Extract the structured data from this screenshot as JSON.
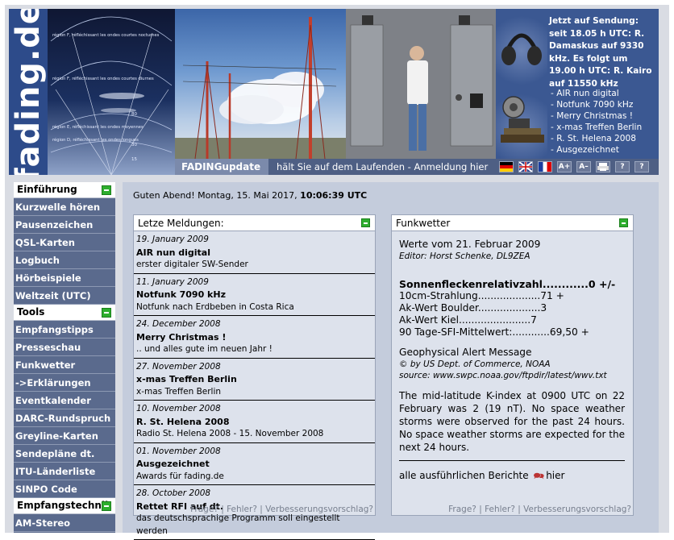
{
  "header": {
    "logo": "fading.de",
    "ionosphere_lines": [
      "région F, réfléchissant les ondes courtes nocturnes",
      "région F, réfléchissant les ondes courtes diurnes",
      "région E, réfléchissant les ondes moyennes",
      "région D, réfléchissant les ondes longues"
    ],
    "ionosphere_scale": [
      "80",
      "30",
      "15"
    ],
    "update_title": "FADINGupdate",
    "update_text": "hält Sie auf dem Laufenden - Anmeldung hier",
    "on_air_text": "Jetzt auf Sendung: seit 18.05 h UTC: R. Damaskus auf 9330 kHz. Es folgt um 19.00 h UTC: R. Kairo auf 11550 kHz",
    "news_ticker": [
      "AIR nun digital",
      "Notfunk 7090 kHz",
      "Merry Christmas !",
      "x-mas Treffen Berlin",
      "R. St. Helena 2008",
      "Ausgezeichnet"
    ],
    "tool_icons": [
      "flag-de-icon",
      "flag-uk-icon",
      "flag-fr-icon",
      "font-larger-icon",
      "font-smaller-icon",
      "print-icon",
      "help-icon",
      "help-icon"
    ],
    "tool_labels": [
      "A+",
      "A–",
      "?",
      "?"
    ]
  },
  "sidebar": {
    "sections": [
      {
        "label": "Einführung",
        "items": [
          "Kurzwelle hören",
          "Pausenzeichen",
          "QSL-Karten",
          "Logbuch",
          "Hörbeispiele",
          "Weltzeit (UTC)"
        ]
      },
      {
        "label": "Tools",
        "items": [
          "Empfangstipps",
          "Presseschau",
          "Funkwetter",
          "->Erklärungen",
          "Eventkalender",
          "DARC-Rundspruch",
          "Greyline-Karten",
          "Sendepläne dt.",
          "ITU-Länderliste",
          "SINPO Code"
        ]
      },
      {
        "label": "Empfangstechnik",
        "items": [
          "AM-Stereo"
        ]
      }
    ]
  },
  "main": {
    "greeting": "Guten Abend! Montag, 15. Mai 2017, ",
    "time": "10:06:39 UTC",
    "news": {
      "title": "Letze Meldungen:",
      "entries": [
        {
          "date": "19. January 2009",
          "title": "AIR nun digital",
          "desc": "erster digitaler SW-Sender"
        },
        {
          "date": "11. January 2009",
          "title": "Notfunk 7090 kHz",
          "desc": "Notfunk nach Erdbeben in Costa Rica"
        },
        {
          "date": "24. December 2008",
          "title": "Merry Christmas !",
          "desc": ".. und alles gute im neuen Jahr !"
        },
        {
          "date": "27. November 2008",
          "title": "x-mas Treffen Berlin",
          "desc": "x-mas Treffen Berlin"
        },
        {
          "date": "10. November 2008",
          "title": "R. St. Helena 2008",
          "desc": "Radio St. Helena 2008 - 15. November 2008"
        },
        {
          "date": "01. November 2008",
          "title": "Ausgezeichnet",
          "desc": "Awards für fading.de"
        },
        {
          "date": "28. October 2008",
          "title": "Rettet RFI auf dt.",
          "desc": "das deutschsprachige Programm soll eingestellt werden"
        }
      ],
      "footer": "Frage? | Fehler? | Verbesserungsvorschlag?"
    },
    "weather": {
      "title": "Funkwetter",
      "values_from": "Werte vom 21. Februar 2009",
      "editor": "Editor: Horst Schenke, DL9ZEA",
      "sunspot": "Sonnenfleckenrelativzahl............0 +/-",
      "lines": [
        "10cm-Strahlung....................71 +",
        "Ak-Wert Boulder....................3",
        "Ak-Wert Kiel.......................7",
        "90 Tage-SFI-Mittelwert:............69,50 +"
      ],
      "alert_title": "Geophysical Alert Message",
      "alert_copyright": "© by US Dept. of Commerce, NOAA",
      "alert_source": "source: www.swpc.noaa.gov/ftpdir/latest/wwv.txt",
      "alert_text": "The mid-latitude K-index at 0900 UTC on 22 February was 2 (19 nT). No space weather storms were observed for the past 24 hours. No space weather storms are expected for the next 24 hours.",
      "more_prefix": "alle ausführlichen Berichte",
      "more_link": "hier",
      "footer": "Frage? | Fehler? | Verbesserungsvorschlag?"
    }
  }
}
